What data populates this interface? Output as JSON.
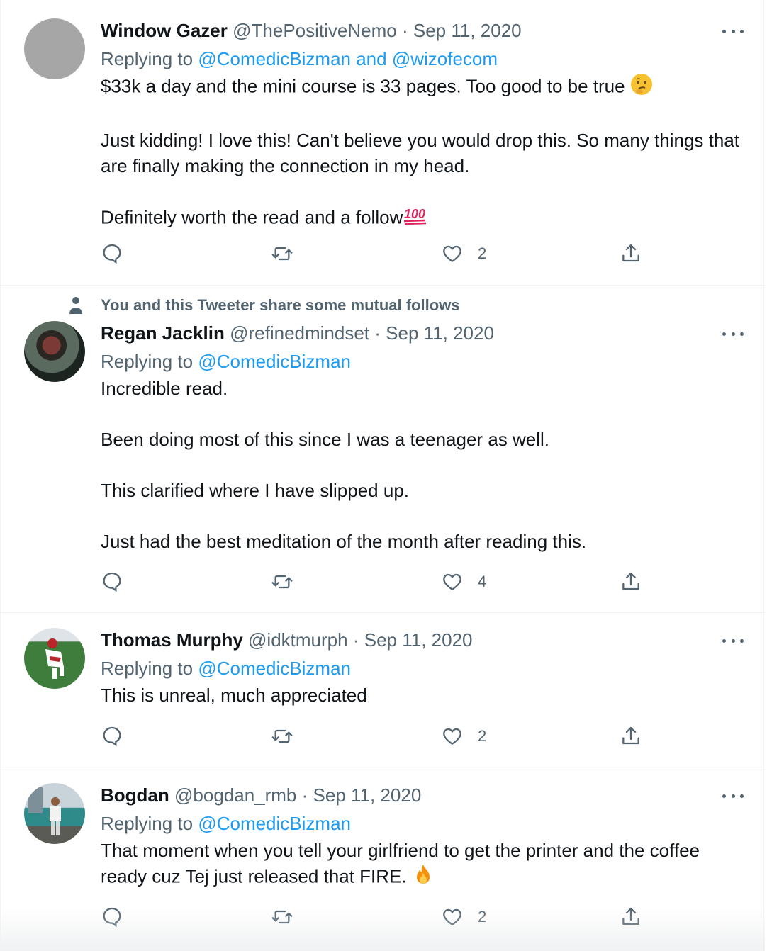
{
  "tweets": [
    {
      "name": "Window Gazer",
      "handle": "@ThePositiveNemo",
      "date": "Sep 11, 2020",
      "replying_prefix": "Replying to",
      "replying_to": "@ComedicBizman and @wizofecom",
      "paragraphs": [
        "$33k a day and the mini course is 33 pages. Too good to be true",
        "Just kidding! I love this! Can't believe you would drop this. So many things that are finally making the connection in my head.",
        "Definitely worth the read and a follow"
      ],
      "emoji_1": "thinking-face",
      "emoji_2": "hundred-points",
      "likes": "2"
    },
    {
      "mutual": "You and this Tweeter share some mutual follows",
      "name": "Regan Jacklin",
      "handle": "@refinedmindset",
      "date": "Sep 11, 2020",
      "replying_prefix": "Replying to",
      "replying_to": "@ComedicBizman",
      "paragraphs": [
        "Incredible read.",
        "Been doing most of this since I was a teenager as well.",
        "This clarified where I have slipped up.",
        "Just had the best meditation of the month after reading this."
      ],
      "likes": "4"
    },
    {
      "name": "Thomas Murphy",
      "handle": "@idktmurph",
      "date": "Sep 11, 2020",
      "replying_prefix": "Replying to",
      "replying_to": "@ComedicBizman",
      "paragraphs": [
        "This is unreal, much appreciated"
      ],
      "likes": "2"
    },
    {
      "name": "Bogdan",
      "handle": "@bogdan_rmb",
      "date": "Sep 11, 2020",
      "replying_prefix": "Replying to",
      "replying_to": "@ComedicBizman",
      "paragraphs": [
        "That moment when you tell your girlfriend to get the printer and the coffee ready cuz Tej just released that FIRE."
      ],
      "emoji_1": "fire",
      "likes": "2"
    }
  ],
  "separator": "·",
  "colors": {
    "link": "#1d9bf0",
    "secondary": "#536471",
    "primary": "#0f1419",
    "divider": "#eff3f4"
  },
  "icons": {
    "reply": "reply-icon",
    "retweet": "retweet-icon",
    "like": "heart-icon",
    "share": "share-icon",
    "more": "more-icon",
    "person": "person-icon"
  }
}
